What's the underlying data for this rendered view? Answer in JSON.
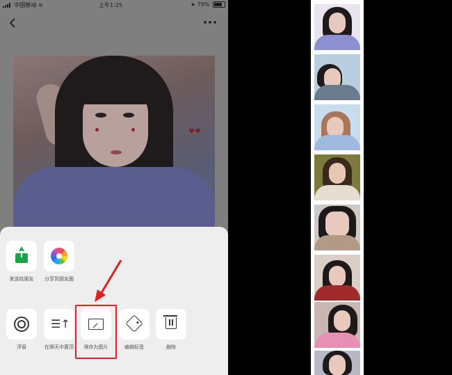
{
  "status_bar": {
    "carrier": "中国移动",
    "time": "上午1:25",
    "battery": "79%",
    "battery_level": 0.79
  },
  "nav": {
    "back_icon": "chevron-left-icon",
    "more_icon": "ellipsis-icon"
  },
  "share_row": [
    {
      "label": "发送给朋友",
      "icon": "share-to-friend-icon"
    },
    {
      "label": "分享到朋友圈",
      "icon": "moments-icon"
    }
  ],
  "action_row": [
    {
      "label": "浮窗",
      "icon": "float-window-icon"
    },
    {
      "label": "在聊天中置顶",
      "icon": "pin-to-top-icon"
    },
    {
      "label": "保存为图片",
      "icon": "save-image-icon"
    },
    {
      "label": "编辑标签",
      "icon": "tag-icon"
    },
    {
      "label": "删除",
      "icon": "trash-icon"
    }
  ],
  "highlight_color": "#e02020",
  "thumbnails_count": 8
}
